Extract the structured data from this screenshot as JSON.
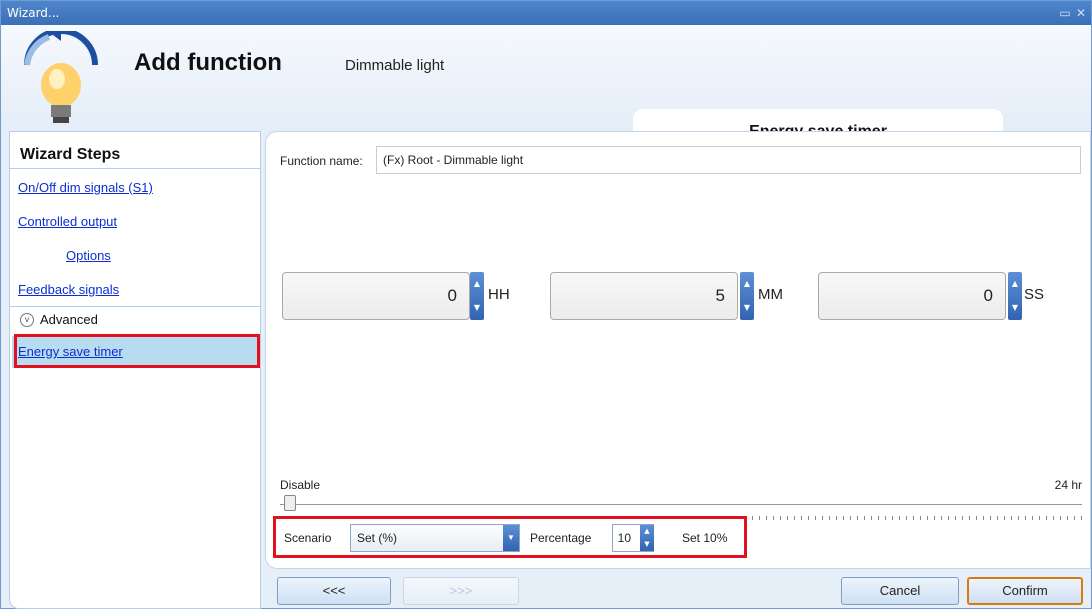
{
  "window": {
    "title": "Wizard...",
    "ctrl_icons": [
      "restore-icon",
      "close-icon"
    ]
  },
  "header": {
    "title": "Add function",
    "subtitle": "Dimmable light"
  },
  "tab": {
    "label": "Energy save timer"
  },
  "sidebar": {
    "heading": "Wizard Steps",
    "items": [
      {
        "label": "On/Off dim signals (S1)"
      },
      {
        "label": "Controlled output"
      },
      {
        "label": "Options"
      },
      {
        "label": "Feedback signals"
      }
    ],
    "advanced_label": "Advanced",
    "selected_label": "Energy save timer"
  },
  "form": {
    "function_name_label": "Function name:",
    "function_name_value": "(Fx) Root - Dimmable light"
  },
  "timer": {
    "hours_value": "0",
    "hours_unit": "HH",
    "minutes_value": "5",
    "minutes_unit": "MM",
    "seconds_value": "0",
    "seconds_unit": "SS"
  },
  "slider": {
    "min_label": "Disable",
    "max_label": "24 hr",
    "position_fraction": 0.0
  },
  "scenario": {
    "scenario_label": "Scenario",
    "scenario_value": "Set (%)",
    "percentage_label": "Percentage",
    "percentage_value": "10",
    "set_text": "Set 10%"
  },
  "buttons": {
    "back": "<<<",
    "next": ">>>",
    "cancel": "Cancel",
    "confirm": "Confirm"
  },
  "colors": {
    "accent": "#3b6fb6",
    "highlight": "#e3111f",
    "selected_bg": "#b8dcef"
  }
}
